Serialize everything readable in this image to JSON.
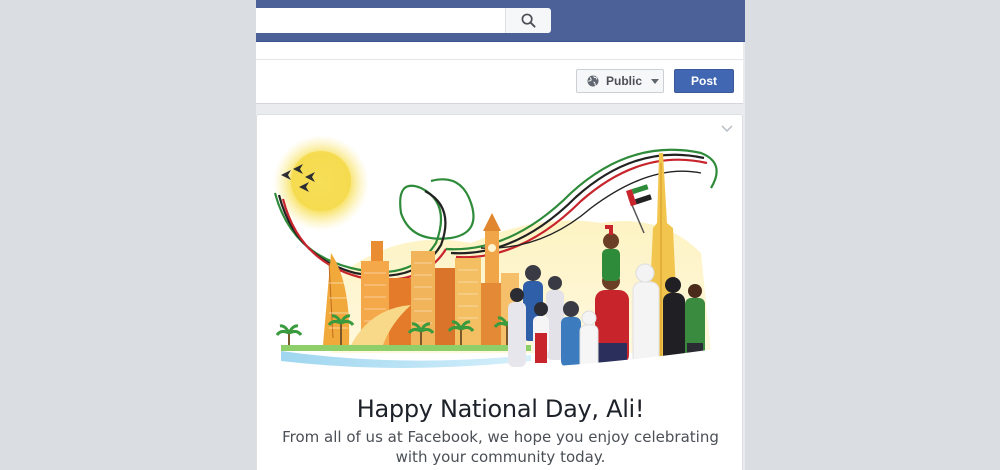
{
  "header": {
    "search": {
      "value": "",
      "placeholder": ""
    },
    "search_icon": "search-icon"
  },
  "composer": {
    "privacy": {
      "label": "Public",
      "icon": "globe-icon"
    },
    "post_label": "Post"
  },
  "card": {
    "menu_icon": "chevron-down-icon",
    "title": "Happy National Day, Ali!",
    "message": "From all of us at Facebook, we hope you enjoy celebrating with your community today."
  },
  "colors": {
    "brand_blue": "#4b6198",
    "post_button": "#4267b2",
    "page_background": "#dadde1",
    "uae_red": "#c8242c",
    "uae_green": "#2e8b3a",
    "uae_black": "#222222"
  }
}
